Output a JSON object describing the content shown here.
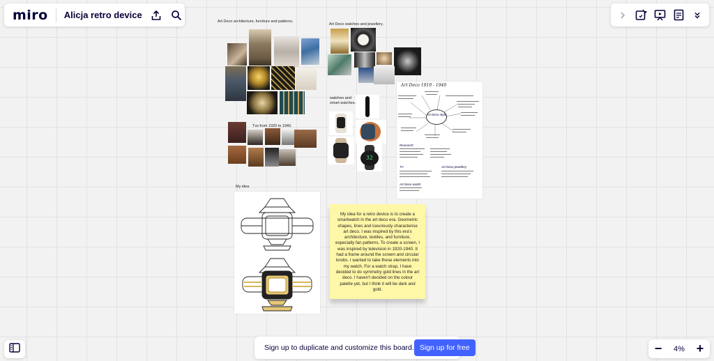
{
  "app": {
    "logo": "miro",
    "board_title": "Alicja retro device"
  },
  "toolbar_left": {
    "icons": [
      "share-icon",
      "search-icon"
    ]
  },
  "toolbar_right": {
    "icons": [
      "chevron-right-icon",
      "sticky-reactions-icon",
      "presentation-icon",
      "notes-icon",
      "chevron-double-down-icon"
    ]
  },
  "board": {
    "label_architecture": "Art Deco architecture, furniture and patterns.",
    "label_watches": "Art Deco watches and jewellery.",
    "label_smartwatches": "watches and\nsmart watches.",
    "label_tv": "Tvs from 1920 to 1940.",
    "label_idea": "My idea",
    "sticky_note": "My idea for a retro device is to create a smartwatch in the art deco era. Geometric shapes, lines and luxuriously characterise art deco. I was inspired by this era's architecture, textiles, and furniture, especially fan patterns. To create a screen, I was inspired by television in 1920-1940. It had a frame around the screen and circular knobs. I wanted to take these elements into my watch. For a watch strap, I have decided to do symmetry gold lines in the art deco. I haven't decided on the colour palette yet, but I think it will be dark and gold.",
    "notes_heading": "Art Deco 1919 - 1940",
    "notes_center": "Art Deco style",
    "notes_research_heading": "Research:",
    "notes_tv_heading": "TV",
    "notes_jewellery_heading": "Art Deco jewellery",
    "notes_watch_heading": "Art Deco watch",
    "smartwatch_time": "32"
  },
  "signup": {
    "text": "Sign up to duplicate and customize this board.",
    "button": "Sign up for free"
  },
  "zoom": {
    "minus": "−",
    "level": "4%",
    "plus": "+"
  },
  "colors": {
    "accent": "#4262ff",
    "sticky": "#fff7a8",
    "gold": "#c9a227"
  }
}
